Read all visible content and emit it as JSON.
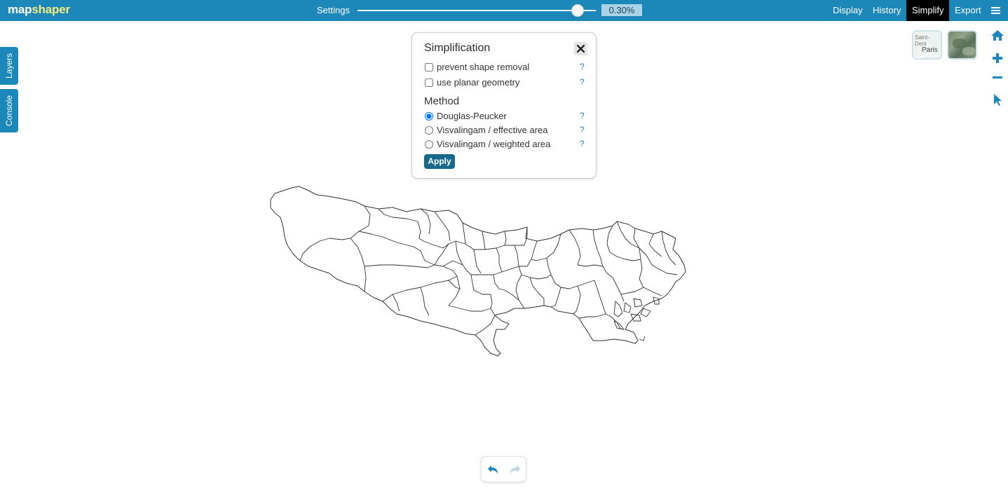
{
  "app": {
    "logo_part1": "map",
    "logo_part2": "shaper",
    "accent_color": "#1c88ba"
  },
  "toolbar": {
    "settings_label": "Settings",
    "simplify_percent": "0.30%",
    "slider_level": 0.93,
    "nav": [
      "Display",
      "History",
      "Simplify",
      "Export"
    ],
    "active_nav": "Simplify",
    "menu_icon": "hamburger-menu-icon"
  },
  "side_tabs": [
    "Layers",
    "Console"
  ],
  "basemaps": {
    "light_label_1": "Saint-Deni",
    "light_label_2": "Paris"
  },
  "right_tools": [
    "home-icon",
    "zoom-in-icon",
    "zoom-out-icon",
    "pointer-icon"
  ],
  "popup": {
    "title": "Simplification",
    "close_icon": "close-icon",
    "options": [
      {
        "label": "prevent shape removal",
        "checked": false
      },
      {
        "label": "use planar geometry",
        "checked": false
      }
    ],
    "method_label": "Method",
    "methods": [
      {
        "label": "Douglas-Peucker",
        "selected": true
      },
      {
        "label": "Visvalingam / effective area",
        "selected": false
      },
      {
        "label": "Visvalingam / weighted area",
        "selected": false
      }
    ],
    "help_text": "?",
    "apply_label": "Apply"
  },
  "history": {
    "undo_icon": "undo-icon",
    "redo_icon": "redo-icon"
  }
}
